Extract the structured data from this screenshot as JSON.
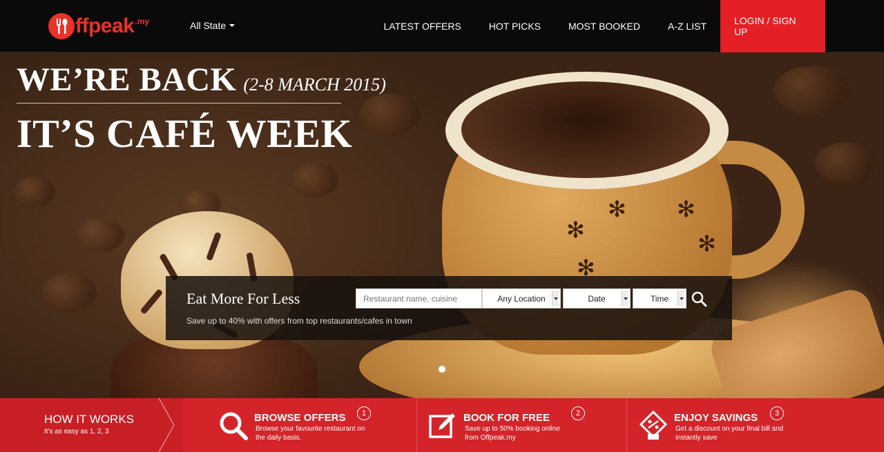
{
  "brand": {
    "logo_text": "ffpeak",
    "logo_suffix": ".my"
  },
  "header": {
    "state_selector": "All State",
    "nav": [
      "LATEST OFFERS",
      "HOT PICKS",
      "MOST BOOKED",
      "A-Z LIST"
    ],
    "login_label": "LOGIN / SIGN UP"
  },
  "hero": {
    "line1": "WE’RE BACK",
    "date": "(2-8 MARCH 2015)",
    "line2": "IT’S CAFÉ WEEK",
    "carousel_active": 1
  },
  "search": {
    "title": "Eat More For Less",
    "subtitle": "Save up to 40% with offers from top restaurants/cafes in town",
    "placeholder": "Restaurant name, cuisine",
    "location": "Any Location",
    "date": "Date",
    "time": "Time"
  },
  "how_it_works": {
    "title": "HOW IT WORKS",
    "subtitle": "It's as easy as 1, 2, 3",
    "steps": [
      {
        "num": "1",
        "title": "BROWSE OFFERS",
        "desc": "Browse your favourite restaurant on the daily basis.",
        "icon": "search-icon"
      },
      {
        "num": "2",
        "title": "BOOK FOR FREE",
        "desc": "Save up to 50% booking online from Offpeak.my",
        "icon": "edit-icon"
      },
      {
        "num": "3",
        "title": "ENJOY SAVINGS",
        "desc": "Get a discount on your final bill and instantly save",
        "icon": "discount-tag-icon"
      }
    ]
  },
  "colors": {
    "brand_red": "#e41f26",
    "header_bg": "#0a0a0a"
  }
}
